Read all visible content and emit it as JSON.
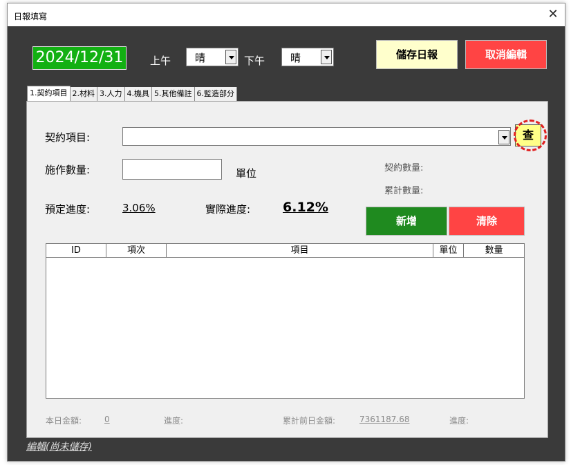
{
  "window": {
    "title": "日報填寫",
    "close_glyph": "✕"
  },
  "header": {
    "date": "2024/12/31",
    "am_label": "上午",
    "am_weather": "晴",
    "pm_label": "下午",
    "pm_weather": "晴",
    "save_label": "儲存日報",
    "cancel_label": "取消編輯"
  },
  "tabs": [
    "1.契約項目",
    "2.材料",
    "3.人力",
    "4.機具",
    "5.其他備註",
    "6.監造部分"
  ],
  "form": {
    "contract_item_label": "契約項目:",
    "contract_item_value": "",
    "search_label": "查",
    "work_qty_label": "施作數量:",
    "work_qty_value": "",
    "unit_label": "單位",
    "contract_qty_label": "契約數量:",
    "cumulative_qty_label": "累計數量:",
    "planned_progress_label": "預定進度:",
    "planned_progress_value": "3.06%",
    "actual_progress_label": "實際進度:",
    "actual_progress_value": "6.12%",
    "add_label": "新增",
    "clear_label": "清除"
  },
  "list": {
    "columns": [
      "ID",
      "項次",
      "項目",
      "單位",
      "數量"
    ],
    "rows": []
  },
  "footer": {
    "today_amount_label": "本日金額:",
    "today_amount_value": "0",
    "progress_label_1": "進度:",
    "prev_cumulative_label": "累計前日金額:",
    "prev_cumulative_value": "7361187.68",
    "progress_label_2": "進度:"
  },
  "status": "編輯(尚未儲存)",
  "colors": {
    "date_bg": "#12b012",
    "save_bg": "#ffffcc",
    "cancel_bg": "#ff4444",
    "add_bg": "#1f8a1f",
    "clear_bg": "#ff4444",
    "search_bg": "#ffff88",
    "highlight": "#e02020"
  }
}
